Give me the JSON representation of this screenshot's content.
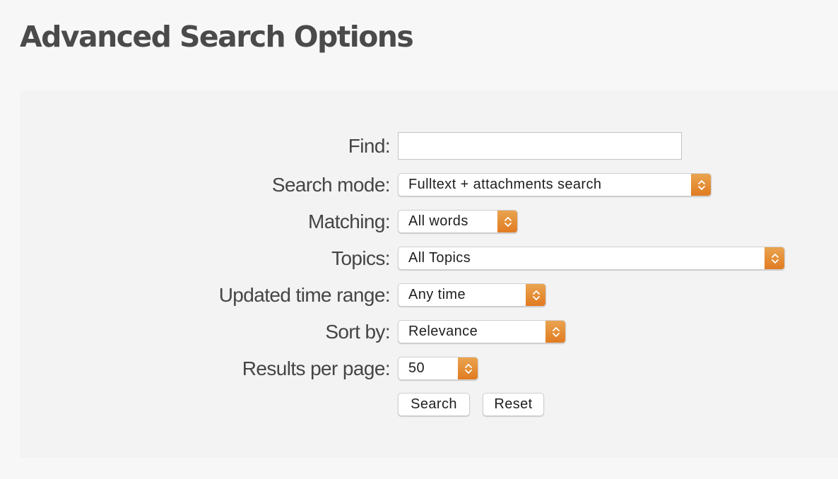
{
  "page": {
    "title": "Advanced Search Options"
  },
  "form": {
    "find": {
      "label": "Find:",
      "value": "",
      "placeholder": ""
    },
    "search_mode": {
      "label": "Search mode:",
      "selected": "Fulltext + attachments search"
    },
    "matching": {
      "label": "Matching:",
      "selected": "All words"
    },
    "topics": {
      "label": "Topics:",
      "selected": "All Topics"
    },
    "updated_time_range": {
      "label": "Updated time range:",
      "selected": "Any time"
    },
    "sort_by": {
      "label": "Sort by:",
      "selected": "Relevance"
    },
    "results_per_page": {
      "label": "Results per page:",
      "selected": "50"
    },
    "buttons": {
      "search": "Search",
      "reset": "Reset"
    }
  },
  "icons": {
    "select_arrows": "up-down-chevron-icon"
  },
  "colors": {
    "accent": "#e38a35",
    "page_bg": "#f7f7f7",
    "panel_bg": "#f3f3f3",
    "title_text": "#4a4a4a"
  }
}
